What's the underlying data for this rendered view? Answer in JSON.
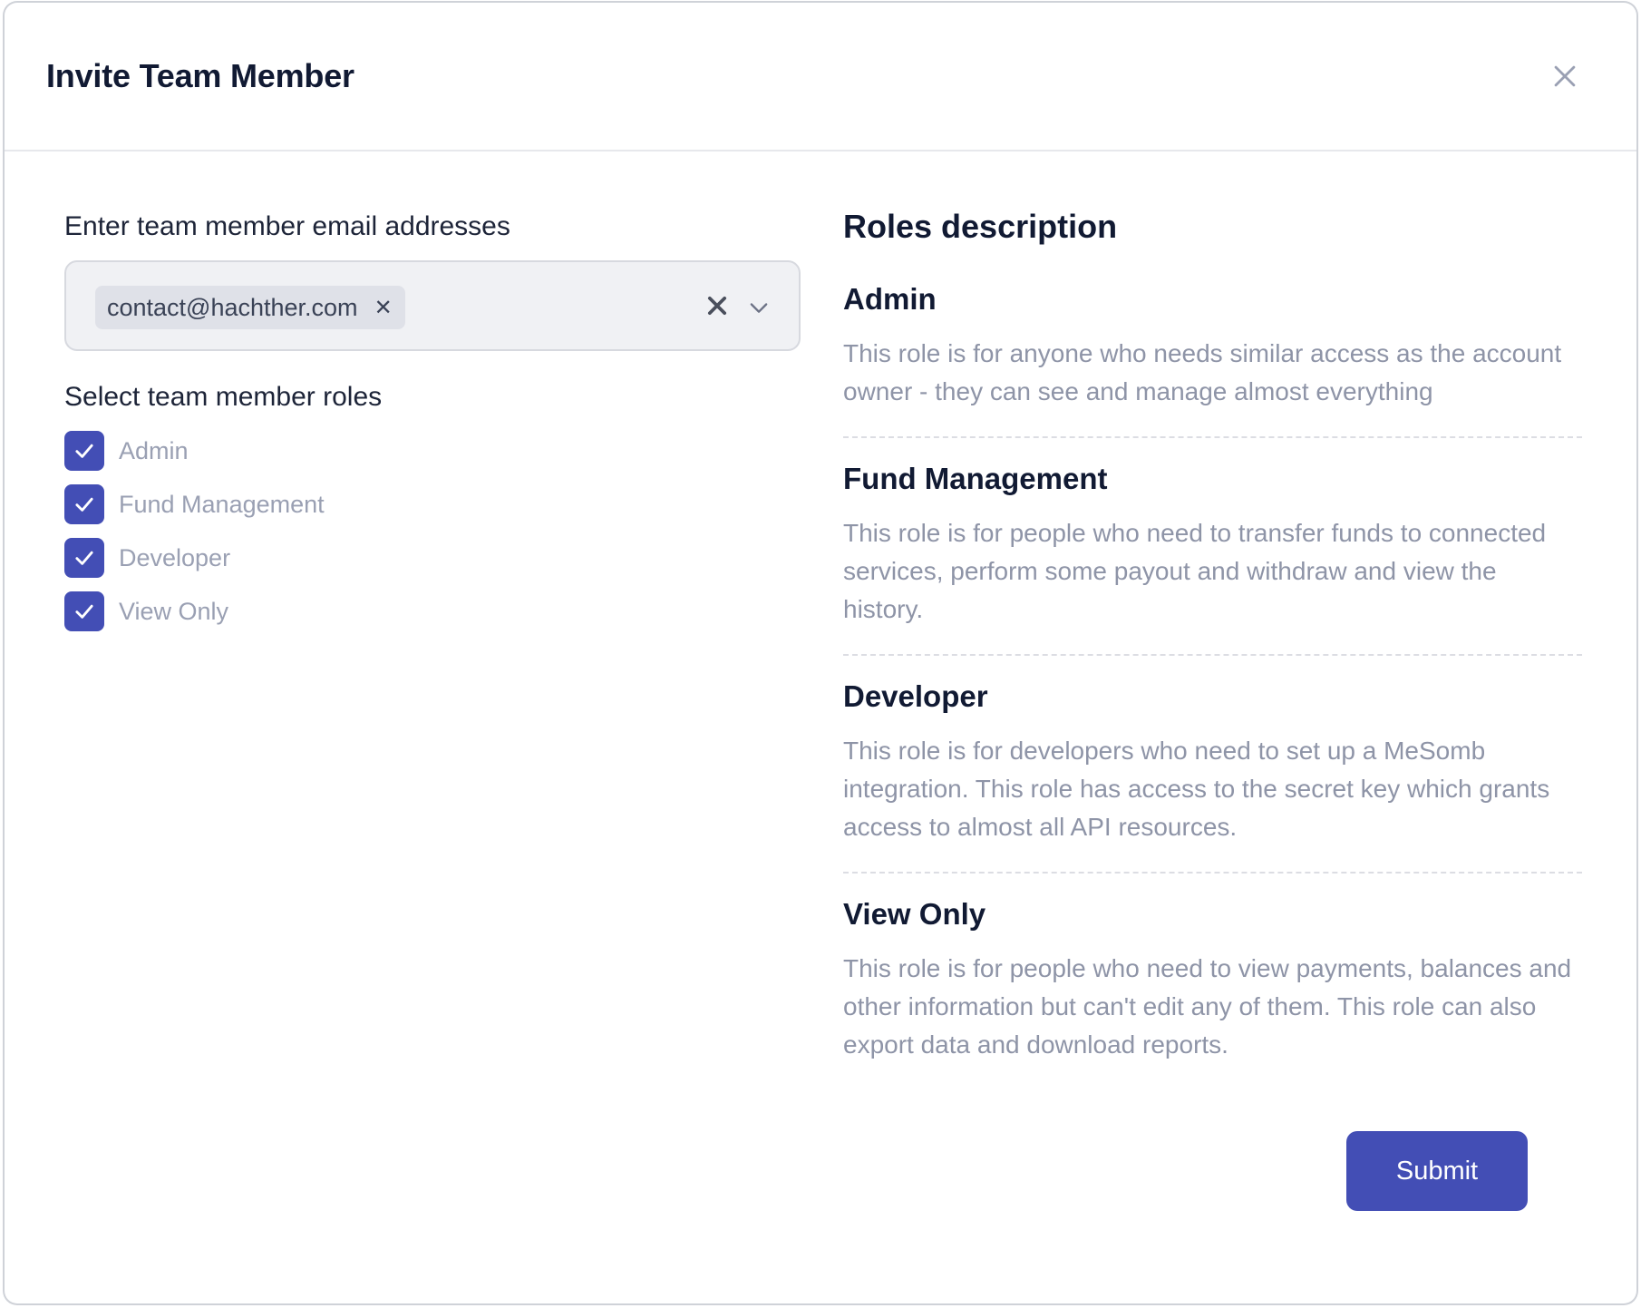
{
  "dialog": {
    "title": "Invite Team Member"
  },
  "email": {
    "label": "Enter team member email addresses",
    "selected": [
      "contact@hachther.com"
    ]
  },
  "roles": {
    "label": "Select team member roles",
    "options": [
      {
        "label": "Admin",
        "checked": true
      },
      {
        "label": "Fund Management",
        "checked": true
      },
      {
        "label": "Developer",
        "checked": true
      },
      {
        "label": "View Only",
        "checked": true
      }
    ]
  },
  "descriptions": {
    "title": "Roles description",
    "items": [
      {
        "title": "Admin",
        "text": "This role is for anyone who needs similar access as the account owner - they can see and manage almost everything"
      },
      {
        "title": "Fund Management",
        "text": "This role is for people who need to transfer funds to connected services, perform some payout and withdraw and view the history."
      },
      {
        "title": "Developer",
        "text": "This role is for developers who need to set up a MeSomb integration. This role has access to the secret key which grants access to almost all API resources."
      },
      {
        "title": "View Only",
        "text": "This role is for people who need to view payments, balances and other information but can't edit any of them. This role can also export data and download reports."
      }
    ]
  },
  "actions": {
    "submit_label": "Submit"
  },
  "colors": {
    "accent": "#434eb5",
    "title": "#111a33",
    "muted": "#8e94a7"
  },
  "icons": {
    "close": "close-icon",
    "chip_remove": "x-icon",
    "clear": "clear-icon",
    "dropdown": "chevron-down-icon",
    "check": "check-icon"
  }
}
